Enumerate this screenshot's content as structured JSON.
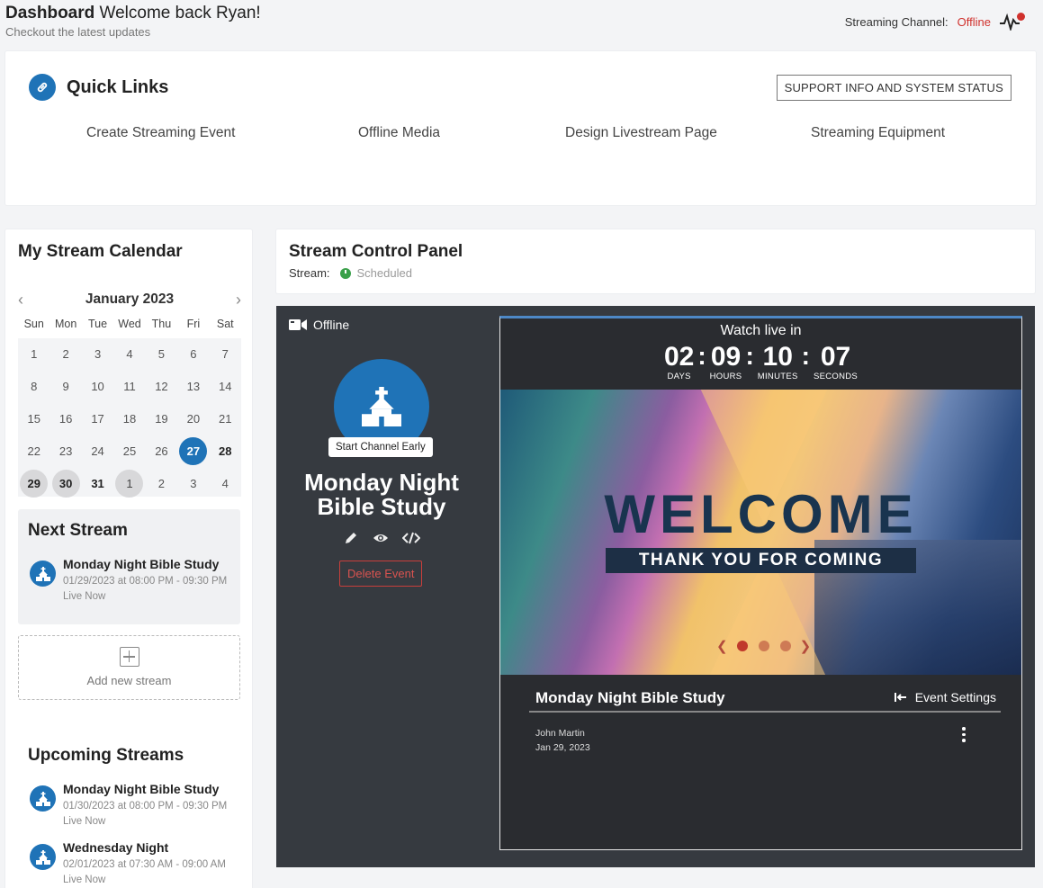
{
  "header": {
    "title_bold": "Dashboard",
    "title_rest": " Welcome back Ryan!",
    "subtitle": "Checkout the latest updates",
    "channel_label": "Streaming Channel:",
    "channel_status": "Offline"
  },
  "quick_links": {
    "title": "Quick Links",
    "support_button": "SUPPORT INFO AND SYSTEM STATUS",
    "links": [
      "Create Streaming Event",
      "Offline Media",
      "Design Livestream Page",
      "Streaming Equipment"
    ]
  },
  "calendar": {
    "title": "My Stream Calendar",
    "month": "January 2023",
    "weekdays": [
      "Sun",
      "Mon",
      "Tue",
      "Wed",
      "Thu",
      "Fri",
      "Sat"
    ],
    "weeks": [
      [
        "1",
        "2",
        "3",
        "4",
        "5",
        "6",
        "7"
      ],
      [
        "8",
        "9",
        "10",
        "11",
        "12",
        "13",
        "14"
      ],
      [
        "15",
        "16",
        "17",
        "18",
        "19",
        "20",
        "21"
      ],
      [
        "22",
        "23",
        "24",
        "25",
        "26",
        "27",
        "28"
      ],
      [
        "29",
        "30",
        "31",
        "1",
        "2",
        "3",
        "4"
      ]
    ],
    "selected_day": "27"
  },
  "next_stream": {
    "title": "Next Stream",
    "name": "Monday Night Bible Study",
    "time": "01/29/2023 at 08:00 PM - 09:30 PM",
    "status": "Live Now"
  },
  "add_stream_label": "Add new stream",
  "upcoming": {
    "title": "Upcoming Streams",
    "items": [
      {
        "name": "Monday Night Bible Study",
        "time": "01/30/2023 at 08:00 PM - 09:30 PM",
        "status": "Live Now"
      },
      {
        "name": "Wednesday Night",
        "time": "02/01/2023 at 07:30 AM - 09:00 AM",
        "status": "Live Now"
      }
    ]
  },
  "control_panel": {
    "title": "Stream Control Panel",
    "stream_label": "Stream:",
    "stream_status": "Scheduled",
    "channel_state": "Offline",
    "tooltip": "Start Channel Early",
    "event_name_line1": "Monday Night",
    "event_name_line2": "Bible Study",
    "delete_button": "Delete Event"
  },
  "preview": {
    "watch_label": "Watch live in",
    "countdown": [
      {
        "value": "02",
        "label": "DAYS"
      },
      {
        "value": "09",
        "label": "HOURS"
      },
      {
        "value": "10",
        "label": "MINUTES"
      },
      {
        "value": "07",
        "label": "SECONDS"
      }
    ],
    "banner_title": "WELCOME",
    "banner_subtitle": "THANK YOU FOR COMING",
    "event_title": "Monday Night Bible Study",
    "event_settings": "Event Settings",
    "author": "John Martin",
    "date": "Jan 29, 2023"
  },
  "colors": {
    "accent": "#1f73b7",
    "offline": "#d0312d",
    "scheduled": "#3aa04a",
    "panel_dark": "#363a40"
  }
}
